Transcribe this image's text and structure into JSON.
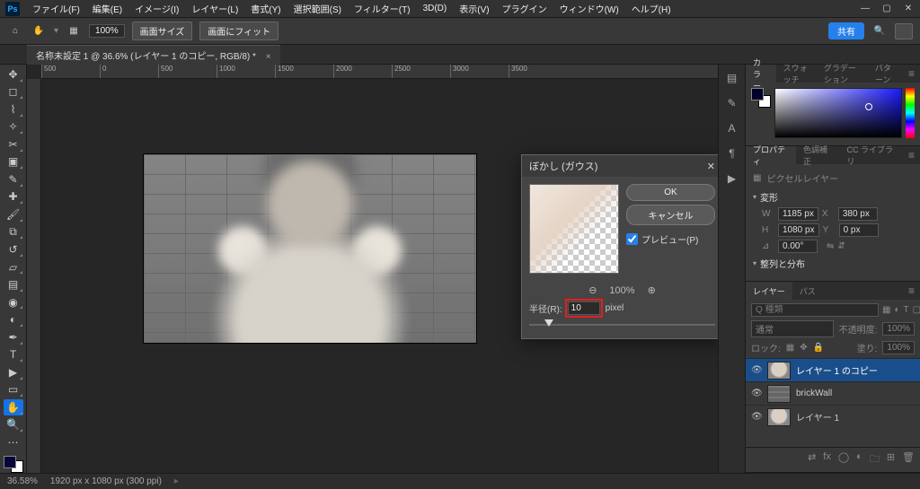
{
  "menubar": {
    "items": [
      "ファイル(F)",
      "編集(E)",
      "イメージ(I)",
      "レイヤー(L)",
      "書式(Y)",
      "選択範囲(S)",
      "フィルター(T)",
      "3D(D)",
      "表示(V)",
      "プラグイン",
      "ウィンドウ(W)",
      "ヘルプ(H)"
    ]
  },
  "optionbar": {
    "zoom_value": "100%",
    "btn_canvas_size": "画面サイズ",
    "btn_fit": "画面にフィット",
    "share": "共有"
  },
  "doc_tab": {
    "title": "名称未設定 1 @ 36.6% (レイヤー 1 のコピー, RGB/8) *"
  },
  "ruler": {
    "marks": [
      "500",
      "0",
      "500",
      "1000",
      "1500",
      "2000",
      "2500",
      "3000",
      "3500"
    ]
  },
  "dialog": {
    "title": "ぼかし (ガウス)",
    "ok": "OK",
    "cancel": "キャンセル",
    "preview_label": "プレビュー(P)",
    "zoom": "100%",
    "radius_label": "半径(R):",
    "radius_value": "10",
    "radius_unit": "pixel"
  },
  "panels": {
    "color": {
      "tabs": [
        "カラー",
        "スウォッチ",
        "グラデーション",
        "パターン"
      ]
    },
    "properties": {
      "tabs": [
        "プロパティ",
        "色調補正",
        "CC ライブラリ"
      ],
      "header": "ピクセルレイヤー",
      "section_transform": "変形",
      "W": "1185 px",
      "X": "380 px",
      "H": "1080 px",
      "Y": "0 px",
      "angle": "0.00°",
      "section_align": "整列と分布"
    },
    "layers": {
      "tabs": [
        "レイヤー",
        "パス"
      ],
      "search_placeholder": "Q 種類",
      "blend": "通常",
      "opacity_label": "不透明度:",
      "opacity_val": "100%",
      "lock_label": "ロック:",
      "fill_label": "塗り:",
      "fill_val": "100%",
      "items": [
        {
          "name": "レイヤー 1 のコピー",
          "thumb": "kid",
          "selected": true
        },
        {
          "name": "brickWall",
          "thumb": "brick",
          "selected": false
        },
        {
          "name": "レイヤー 1",
          "thumb": "kid",
          "selected": false
        }
      ]
    }
  },
  "statusbar": {
    "zoom": "36.58%",
    "docinfo": "1920 px x 1080 px (300 ppi)"
  }
}
